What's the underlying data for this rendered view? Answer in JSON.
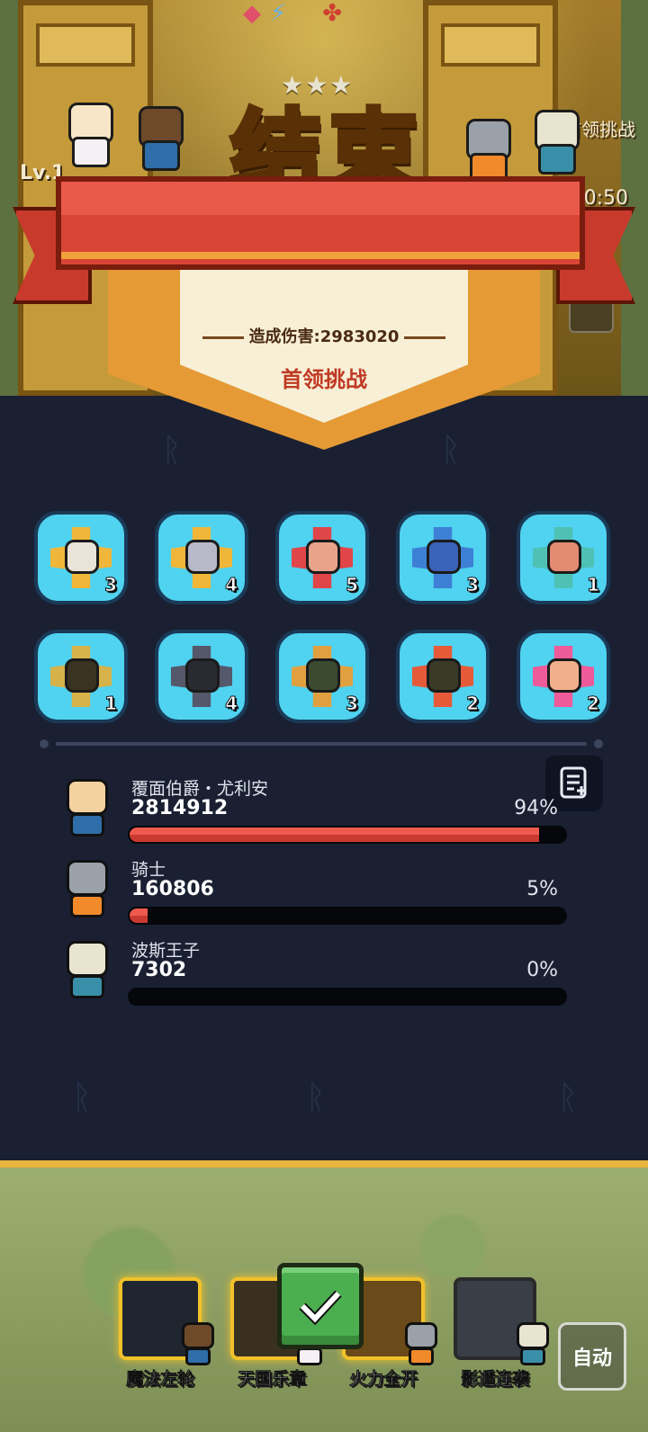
{
  "header": {
    "level_label": "Lv.1",
    "corner_label": "首领挑战",
    "corner_time": "0:50",
    "stars": "★★★",
    "title": "结束"
  },
  "result": {
    "damage_text": "造成伤害:2983020",
    "mode": "首领挑战"
  },
  "heroes": [
    {
      "level": "3",
      "frame_color": "#f0b63a",
      "face_color": "#e9e3d8"
    },
    {
      "level": "4",
      "frame_color": "#f0b63a",
      "face_color": "#b8b8c8"
    },
    {
      "level": "5",
      "frame_color": "#e0454a",
      "face_color": "#e9a38b"
    },
    {
      "level": "3",
      "frame_color": "#3e7fd6",
      "face_color": "#3a62b8"
    },
    {
      "level": "1",
      "frame_color": "#4fc1b4",
      "face_color": "#e38b72"
    },
    {
      "level": "1",
      "frame_color": "#d6b24a",
      "face_color": "#3a3322"
    },
    {
      "level": "4",
      "frame_color": "#55576a",
      "face_color": "#2a2a32"
    },
    {
      "level": "3",
      "frame_color": "#e0a040",
      "face_color": "#3c4a30"
    },
    {
      "level": "2",
      "frame_color": "#e65a3a",
      "face_color": "#3b3a26"
    },
    {
      "level": "2",
      "frame_color": "#ef5a9a",
      "face_color": "#f0b08a"
    }
  ],
  "damage": [
    {
      "name": "覆面伯爵・尤利安",
      "value": "2814912",
      "percent": "94%",
      "fill": 0.94,
      "head_color": "#f4d2a0",
      "body_color": "#2f6ea8"
    },
    {
      "name": "骑士",
      "value": "160806",
      "percent": "5%",
      "fill": 0.05,
      "head_color": "#9aa1a8",
      "body_color": "#f08a2a"
    },
    {
      "name": "波斯王子",
      "value": "7302",
      "percent": "0%",
      "fill": 0.0,
      "head_color": "#e9e4d0",
      "body_color": "#3a8fa8"
    }
  ],
  "skills": [
    {
      "label": "魔法左轮",
      "color": "#20262f",
      "glow": true
    },
    {
      "label": "天国乐章",
      "color": "#3a3020",
      "glow": true
    },
    {
      "label": "火力全开",
      "color": "#6a4a18",
      "glow": true
    },
    {
      "label": "影遁连袭",
      "color": "#3a3e46",
      "glow": false
    }
  ],
  "buttons": {
    "auto": "自动",
    "confirm_icon": "checkmark-icon"
  }
}
